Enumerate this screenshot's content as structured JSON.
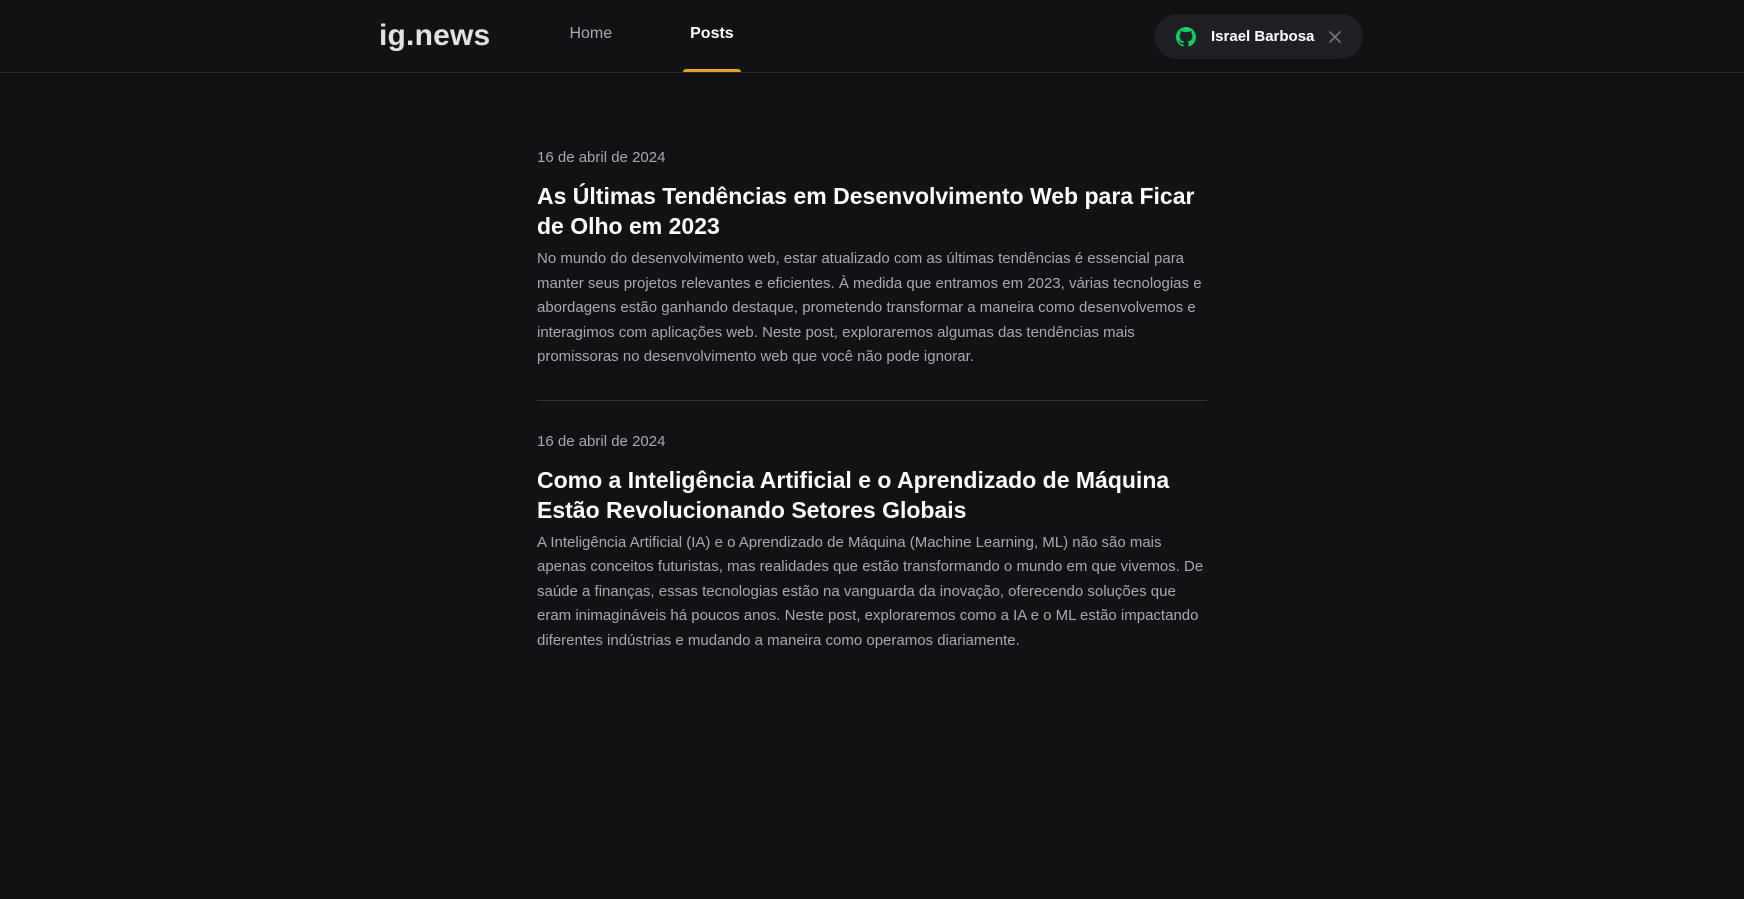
{
  "header": {
    "logo": "ig.news",
    "nav": [
      {
        "label": "Home",
        "active": false
      },
      {
        "label": "Posts",
        "active": true
      }
    ],
    "user": {
      "name": "Israel Barbosa",
      "icon": "github-icon",
      "close_icon": "close-icon"
    }
  },
  "colors": {
    "background": "#121214",
    "accent": "#eba417",
    "github_green": "#04d361",
    "text_muted": "#a8a8b3"
  },
  "posts": [
    {
      "date": "16 de abril de 2024",
      "title": "As Últimas Tendências em Desenvolvimento Web para Ficar de Olho em 2023",
      "excerpt": "No mundo do desenvolvimento web, estar atualizado com as últimas tendências é essencial para manter seus projetos relevantes e eficientes. À medida que entramos em 2023, várias tecnologias e abordagens estão ganhando destaque, prometendo transformar a maneira como desenvolvemos e interagimos com aplicações web. Neste post, exploraremos algumas das tendências mais promissoras no desenvolvimento web que você não pode ignorar."
    },
    {
      "date": "16 de abril de 2024",
      "title": "Como a Inteligência Artificial e o Aprendizado de Máquina Estão Revolucionando Setores Globais",
      "excerpt": "A Inteligência Artificial (IA) e o Aprendizado de Máquina (Machine Learning, ML) não são mais apenas conceitos futuristas, mas realidades que estão transformando o mundo em que vivemos. De saúde a finanças, essas tecnologias estão na vanguarda da inovação, oferecendo soluções que eram inimagináveis há poucos anos. Neste post, exploraremos como a IA e o ML estão impactando diferentes indústrias e mudando a maneira como operamos diariamente."
    }
  ]
}
